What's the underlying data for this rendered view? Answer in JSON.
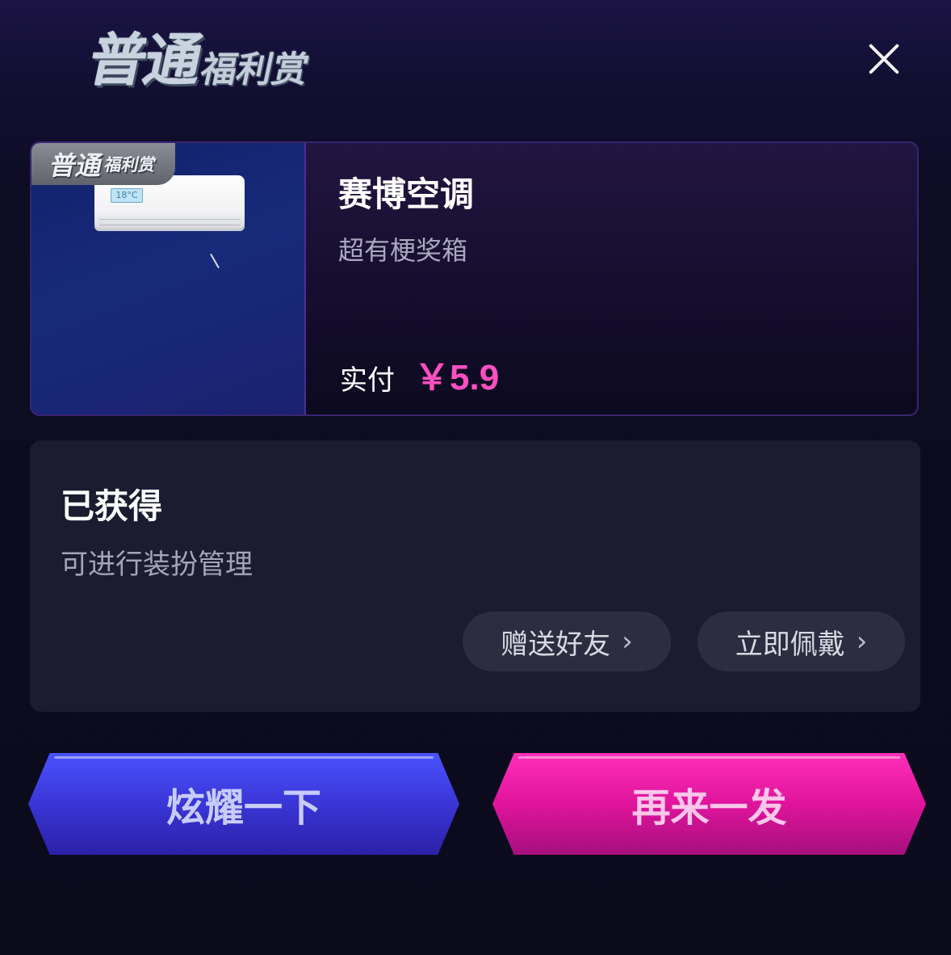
{
  "header": {
    "title_main": "普通",
    "title_sub": "福利赏",
    "close_icon": "close-icon"
  },
  "prize": {
    "tag_main": "普通",
    "tag_sub": "福利赏",
    "image_icon": "air-conditioner-icon",
    "ac_display": "18°C",
    "name": "赛博空调",
    "subtitle": "超有梗奖箱",
    "price_label": "实付",
    "price_value": "￥5.9"
  },
  "owned": {
    "title": "已获得",
    "subtitle": "可进行装扮管理",
    "gift_label": "赠送好友",
    "wear_label": "立即佩戴",
    "chevron_icon": "chevron-right-icon"
  },
  "actions": {
    "show_label": "炫耀一下",
    "again_label": "再来一发"
  },
  "colors": {
    "price": "#ff4fc0",
    "primary_blue": "#3a35d6",
    "primary_pink": "#e0149c",
    "card_bg": "#1b1c30"
  }
}
